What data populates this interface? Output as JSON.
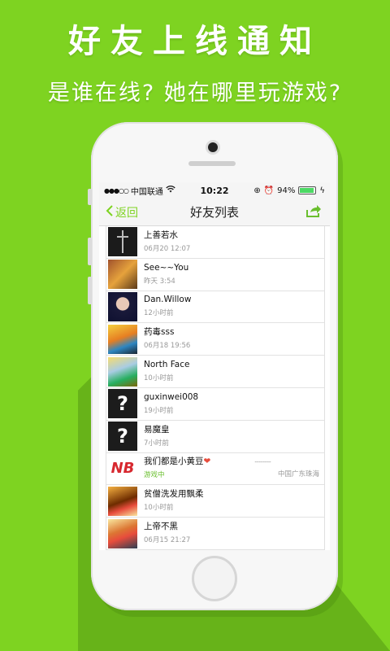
{
  "promo": {
    "headline": "好友上线通知",
    "subline": "是谁在线? 她在哪里玩游戏?"
  },
  "statusbar": {
    "carrier": "中国联通",
    "time": "10:22",
    "battery": "94%",
    "battery_level": 0.94
  },
  "navbar": {
    "back_label": "返回",
    "title": "好友列表",
    "share_icon": "share-icon"
  },
  "friends": [
    {
      "name": "上善若水",
      "time": "06月20 12:07",
      "avatar": "cross"
    },
    {
      "name": "See~~You",
      "time": "昨天 3:54",
      "avatar": "pirate"
    },
    {
      "name": "Dan.Willow",
      "time": "12小时前",
      "avatar": "girl"
    },
    {
      "name": "药毒sss",
      "time": "06月18 19:56",
      "avatar": "bird"
    },
    {
      "name": "North Face",
      "time": "10小时前",
      "avatar": "bee"
    },
    {
      "name": "guxinwei008",
      "time": "19小时前",
      "avatar": "question"
    },
    {
      "name": "易魔皇",
      "time": "7小时前",
      "avatar": "question"
    },
    {
      "name": "我们都是小黄豆",
      "heart": "❤",
      "status": "游戏中",
      "location": "中国广东珠海",
      "avatar": "nb",
      "marks": "ˉˉˉˉˉˉˉˉ"
    },
    {
      "name": "贫僧洗发用飘柔",
      "time": "10小时前",
      "avatar": "hammer"
    },
    {
      "name": "上帝不黑",
      "time": "06月15 21:27",
      "avatar": "op"
    }
  ],
  "colors": {
    "background": "#7ed321",
    "accent": "#7ed321",
    "online": "#6abf2e"
  }
}
